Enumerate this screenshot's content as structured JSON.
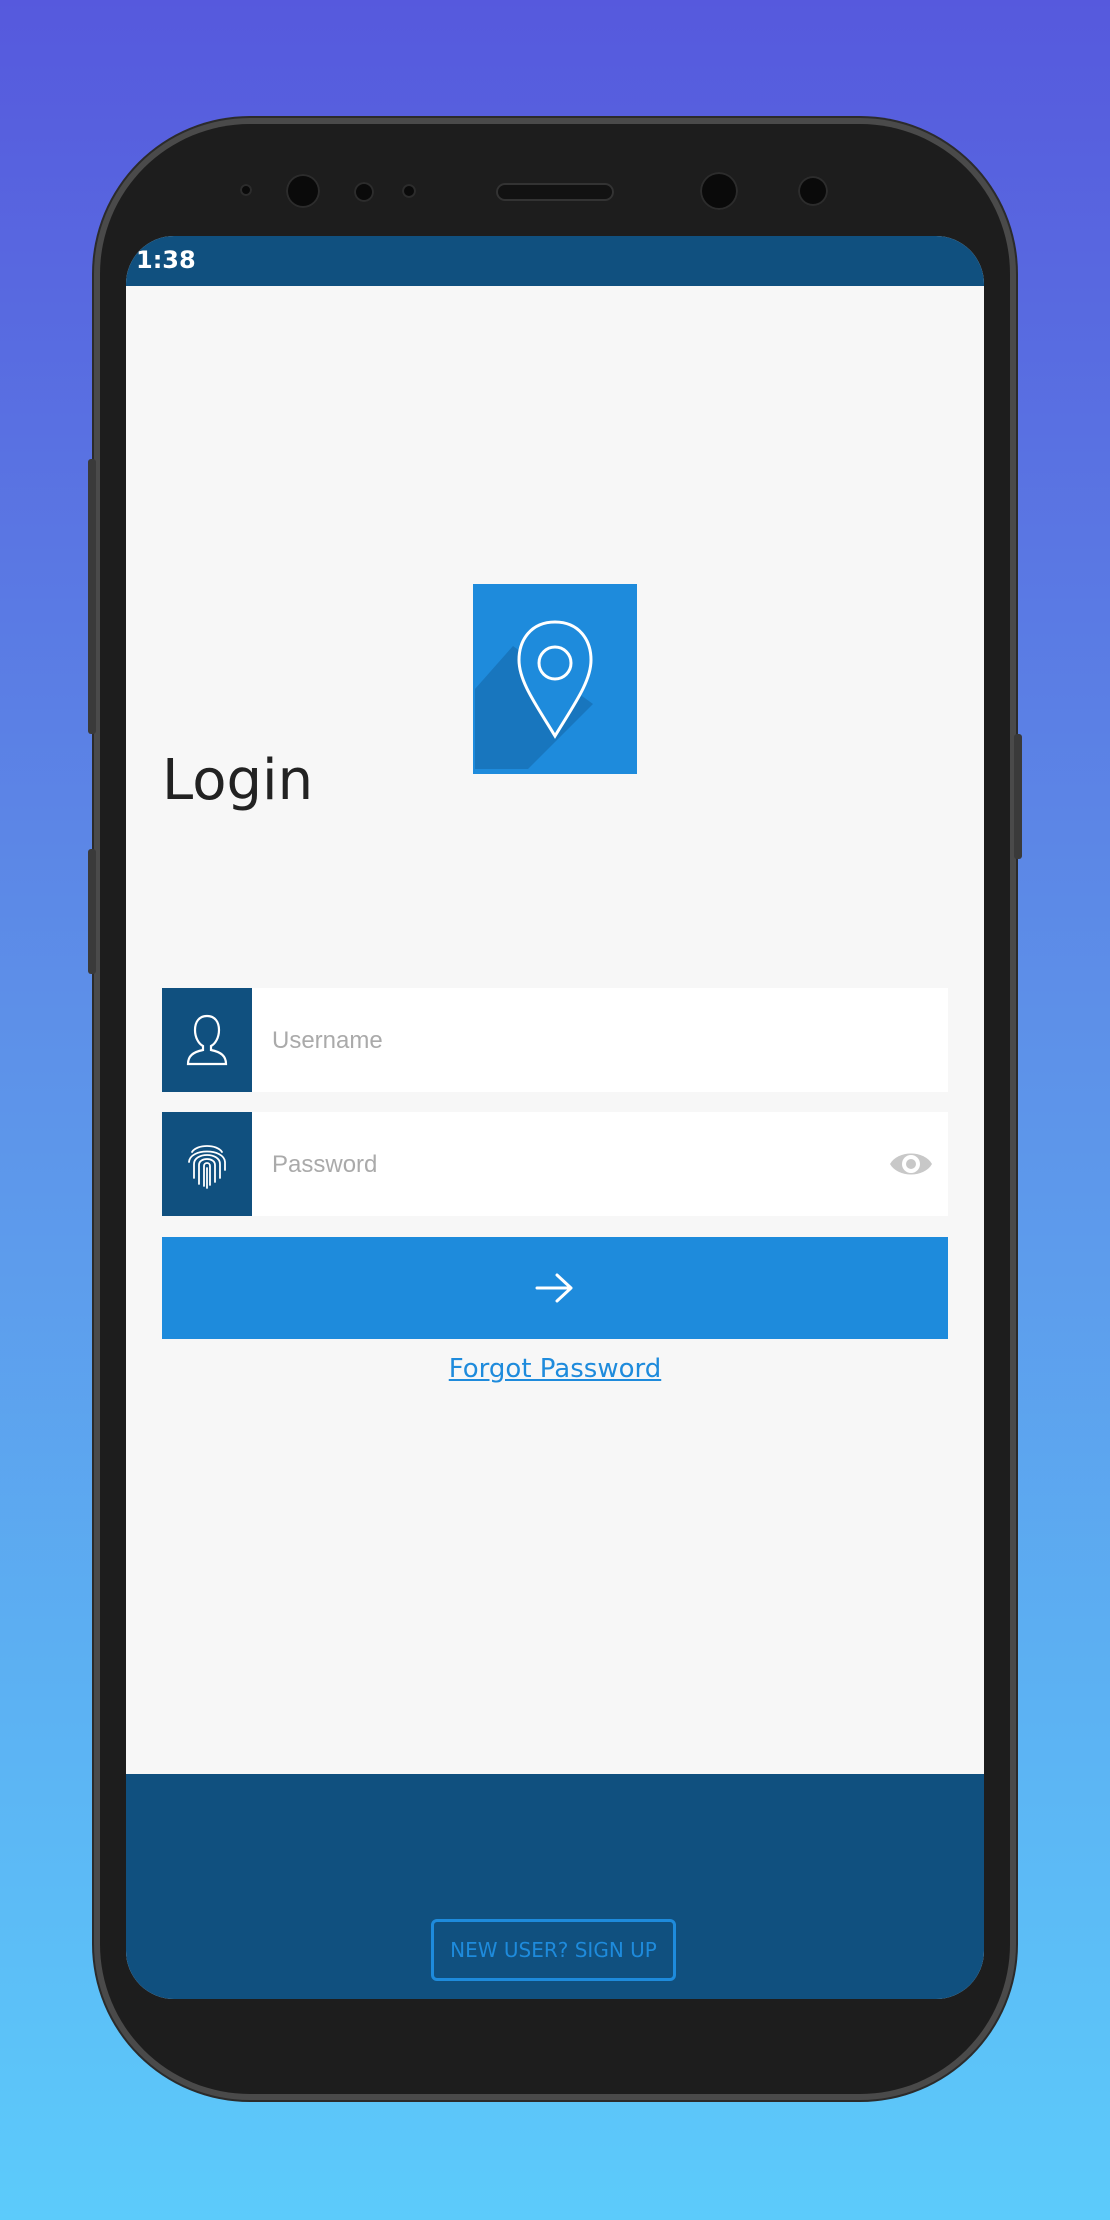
{
  "status_bar": {
    "time": "1:38"
  },
  "logo": {
    "icon": "location-pin-icon",
    "background": "#1E8BDC"
  },
  "login": {
    "title": "Login",
    "username": {
      "placeholder": "Username",
      "value": "",
      "icon": "user-icon"
    },
    "password": {
      "placeholder": "Password",
      "value": "",
      "icon": "fingerprint-icon",
      "toggle_icon": "eye-icon"
    },
    "submit": {
      "icon": "arrow-right-icon"
    },
    "forgot_password": "Forgot Password"
  },
  "footer": {
    "signup_label": "NEW USER? SIGN UP"
  },
  "colors": {
    "primary": "#1E8BDC",
    "dark_primary": "#10507F",
    "background": "#F7F7F7"
  }
}
